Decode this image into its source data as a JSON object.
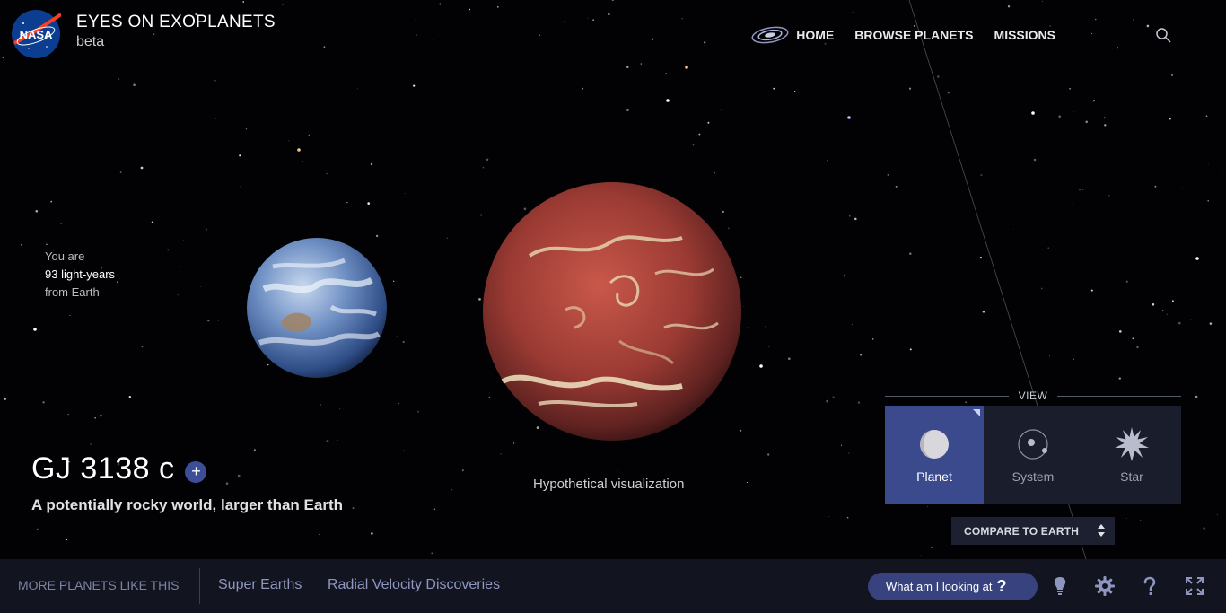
{
  "header": {
    "app_title": "EYES ON EXOPLANETS",
    "app_subtitle": "beta",
    "logo_text": "NASA",
    "nav": [
      {
        "label": "HOME",
        "icon": "galaxy-icon"
      },
      {
        "label": "BROWSE PLANETS"
      },
      {
        "label": "MISSIONS"
      }
    ],
    "search_icon": "search-icon"
  },
  "distance": {
    "line1": "You are",
    "value": "93 light-years",
    "line3": "from Earth"
  },
  "planet": {
    "name": "GJ 3138 c",
    "add_label": "+",
    "description": "A potentially rocky world, larger than Earth",
    "visual_caption": "Hypothetical visualization"
  },
  "view_panel": {
    "title": "VIEW",
    "options": [
      {
        "label": "Planet",
        "icon": "planet-icon",
        "active": true
      },
      {
        "label": "System",
        "icon": "system-icon",
        "active": false
      },
      {
        "label": "Star",
        "icon": "star-icon",
        "active": false
      }
    ]
  },
  "compare": {
    "label": "COMPARE TO EARTH"
  },
  "bottom_bar": {
    "more_label": "MORE PLANETS LIKE THIS",
    "chips": [
      "Super Earths",
      "Radial Velocity Discoveries"
    ],
    "looking_label": "What am I looking at",
    "looking_q": "?",
    "icons": [
      "lightbulb-icon",
      "gear-icon",
      "help-icon",
      "fullscreen-icon"
    ]
  },
  "colors": {
    "accent": "#3a4a8c",
    "bottom_bar": "#121420",
    "chip_text": "#8e96c0"
  }
}
